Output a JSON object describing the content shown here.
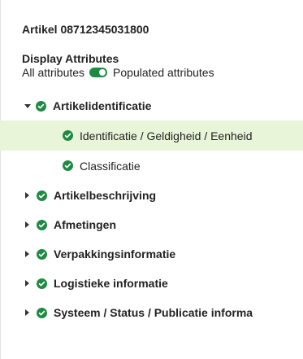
{
  "article": {
    "title": "Artikel 08712345031800"
  },
  "display_attributes": {
    "heading": "Display Attributes",
    "left_option": "All attributes",
    "right_option": "Populated attributes",
    "toggle_state": "populated"
  },
  "colors": {
    "accent": "#1f8a44",
    "selected_row": "#e8f5d8"
  },
  "icons": {
    "expand": "caret-right-icon",
    "collapse": "caret-down-icon",
    "status": "check-circle-icon"
  },
  "tree": {
    "groups": [
      {
        "label": "Artikelidentificatie",
        "expanded": true,
        "children": [
          {
            "label": "Identificatie / Geldigheid / Eenheid",
            "selected": true
          },
          {
            "label": "Classificatie",
            "selected": false
          }
        ]
      },
      {
        "label": "Artikelbeschrijving",
        "expanded": false
      },
      {
        "label": "Afmetingen",
        "expanded": false
      },
      {
        "label": "Verpakkingsinformatie",
        "expanded": false
      },
      {
        "label": "Logistieke informatie",
        "expanded": false
      },
      {
        "label": "Systeem / Status / Publicatie informa",
        "expanded": false
      }
    ]
  }
}
